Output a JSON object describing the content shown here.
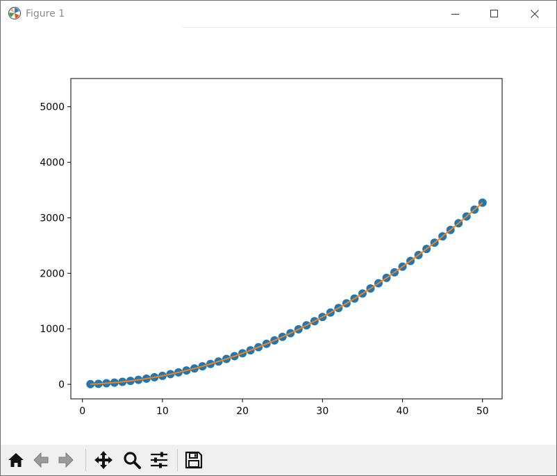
{
  "window": {
    "title": "Figure 1",
    "controls": [
      "minimize",
      "maximize",
      "close"
    ]
  },
  "toolbar": {
    "items": [
      {
        "icon": "home-icon",
        "tooltip": "Home"
      },
      {
        "icon": "back-arrow-icon",
        "tooltip": "Back"
      },
      {
        "icon": "forward-arrow-icon",
        "tooltip": "Forward"
      },
      {
        "icon": "pan-icon",
        "tooltip": "Pan"
      },
      {
        "icon": "zoom-icon",
        "tooltip": "Zoom"
      },
      {
        "icon": "configure-subplots-icon",
        "tooltip": "Subplots"
      },
      {
        "icon": "save-icon",
        "tooltip": "Save"
      }
    ]
  },
  "chart_data": {
    "type": "scatter",
    "title": "",
    "xlabel": "",
    "ylabel": "",
    "xlim": [
      -1.45,
      52.45
    ],
    "ylim": [
      -262.25,
      5508.25
    ],
    "xticks": [
      0,
      10,
      20,
      30,
      40,
      50
    ],
    "yticks": [
      0,
      1000,
      2000,
      3000,
      4000,
      5000
    ],
    "grid": false,
    "legend": "none",
    "series": [
      {
        "kind": "scatter",
        "color": "#1f77b4",
        "x": [
          1,
          2,
          3,
          4,
          5,
          6,
          7,
          8,
          9,
          10,
          11,
          12,
          13,
          14,
          15,
          16,
          17,
          18,
          19,
          20,
          21,
          22,
          23,
          24,
          25,
          26,
          27,
          28,
          29,
          30,
          31,
          32,
          33,
          34,
          35,
          36,
          37,
          38,
          39,
          40,
          41,
          42,
          43,
          44,
          45,
          46,
          47,
          48,
          49,
          50
        ],
        "y": [
          3,
          9,
          19,
          31,
          45,
          61,
          81,
          103,
          127,
          153,
          183,
          215,
          249,
          285,
          325,
          367,
          411,
          457,
          507,
          559,
          613,
          669,
          729,
          791,
          855,
          921,
          991,
          1063,
          1137,
          1213,
          1293,
          1375,
          1459,
          1545,
          1635,
          1727,
          1821,
          1917,
          2017,
          2119,
          2223,
          2329,
          2439,
          2551,
          2665,
          2781,
          2901,
          3023,
          3147,
          3273
        ]
      },
      {
        "kind": "line",
        "color": "#ff7f0e",
        "x": [
          1,
          2,
          3,
          4,
          5,
          6,
          7,
          8,
          9,
          10,
          11,
          12,
          13,
          14,
          15,
          16,
          17,
          18,
          19,
          20,
          21,
          22,
          23,
          24,
          25,
          26,
          27,
          28,
          29,
          30,
          31,
          32,
          33,
          34,
          35,
          36,
          37,
          38,
          39,
          40,
          41,
          42,
          43,
          44,
          45,
          46,
          47,
          48,
          49,
          50
        ],
        "y": [
          3,
          9,
          19,
          31,
          45,
          61,
          81,
          103,
          127,
          153,
          183,
          215,
          249,
          285,
          325,
          367,
          411,
          457,
          507,
          559,
          613,
          669,
          729,
          791,
          855,
          921,
          991,
          1063,
          1137,
          1213,
          1293,
          1375,
          1459,
          1545,
          1635,
          1727,
          1821,
          1917,
          2017,
          2119,
          2223,
          2329,
          2439,
          2551,
          2665,
          2781,
          2901,
          3023,
          3147,
          3273
        ]
      }
    ]
  }
}
